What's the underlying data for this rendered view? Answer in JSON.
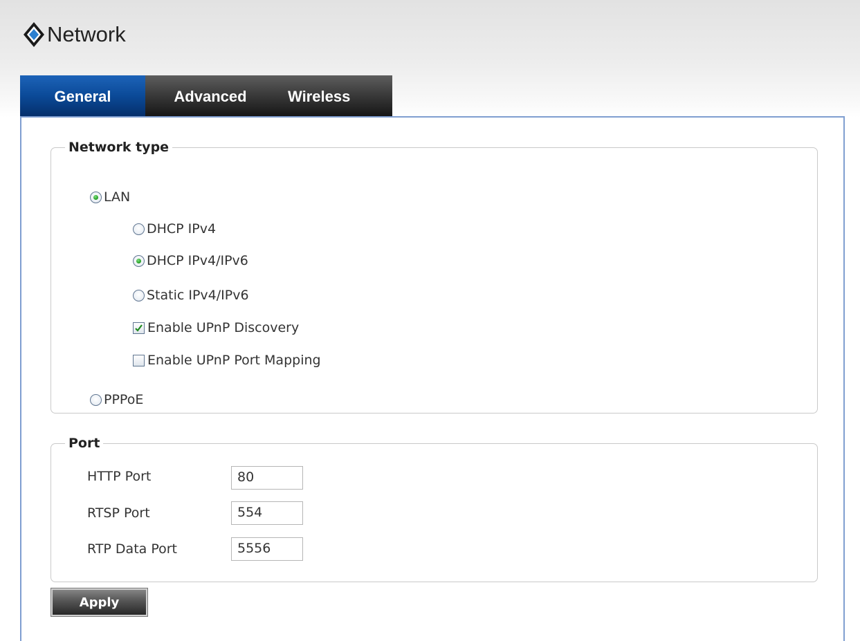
{
  "header": {
    "title": "Network"
  },
  "tabs": [
    {
      "label": "General",
      "active": true
    },
    {
      "label": "Advanced",
      "active": false
    },
    {
      "label": "Wireless",
      "active": false
    }
  ],
  "network_type": {
    "legend": "Network type",
    "lan_label": "LAN",
    "lan_selected": true,
    "options": [
      {
        "label": "DHCP IPv4",
        "selected": false
      },
      {
        "label": "DHCP IPv4/IPv6",
        "selected": true
      },
      {
        "label": "Static IPv4/IPv6",
        "selected": false
      }
    ],
    "checkboxes": [
      {
        "label": "Enable UPnP Discovery",
        "checked": true
      },
      {
        "label": "Enable UPnP Port Mapping",
        "checked": false
      }
    ],
    "pppoe_label": "PPPoE",
    "pppoe_selected": false
  },
  "port": {
    "legend": "Port",
    "fields": [
      {
        "label": "HTTP Port",
        "value": "80"
      },
      {
        "label": "RTSP Port",
        "value": "554"
      },
      {
        "label": "RTP Data Port",
        "value": "5556"
      }
    ]
  },
  "actions": {
    "apply_label": "Apply"
  },
  "colors": {
    "active_tab": "#0b4a98",
    "inactive_tab": "#2a2a2a",
    "panel_border": "#7f9ed0",
    "radio_dot": "#1f9a1f"
  }
}
